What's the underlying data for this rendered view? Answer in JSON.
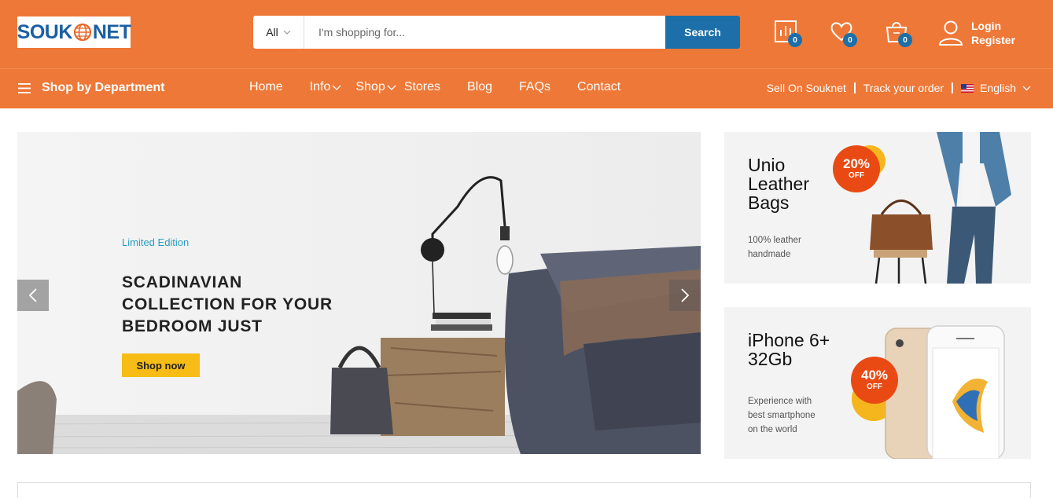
{
  "header": {
    "logo_text": {
      "left": "SOUK",
      "right": "NET"
    },
    "search": {
      "category": "All",
      "placeholder": "I'm shopping for...",
      "button": "Search"
    },
    "icons": [
      {
        "name": "compare-icon",
        "count": "0"
      },
      {
        "name": "wishlist-icon",
        "count": "0"
      },
      {
        "name": "cart-icon",
        "count": "0"
      }
    ],
    "account": {
      "login": "Login",
      "register": "Register"
    }
  },
  "nav": {
    "department": "Shop by Department",
    "items": [
      "Home",
      "Info",
      "Shop",
      "Stores",
      "Blog",
      "FAQs",
      "Contact"
    ],
    "right": {
      "sell": "Sell On Souknet",
      "track": "Track your order",
      "language": "English"
    }
  },
  "hero": {
    "tag": "Limited Edition",
    "title_lines": [
      "SCADINAVIAN",
      "COLLECTION FOR YOUR",
      "BEDROOM JUST"
    ],
    "button": "Shop now"
  },
  "banners": [
    {
      "title_lines": [
        "Unio",
        "Leather",
        "Bags"
      ],
      "sub_lines": [
        "100% leather",
        "handmade"
      ],
      "discount": "20%",
      "off": "OFF"
    },
    {
      "title_lines": [
        "iPhone 6+",
        "32Gb"
      ],
      "sub_lines": [
        "Experience with",
        "best smartphone",
        "on the world"
      ],
      "discount": "40%",
      "off": "OFF"
    }
  ],
  "colors": {
    "brand_orange": "#ee7837",
    "brand_blue": "#1c6fa8",
    "button_yellow": "#f7bc15",
    "discount_red": "#e94a13"
  }
}
